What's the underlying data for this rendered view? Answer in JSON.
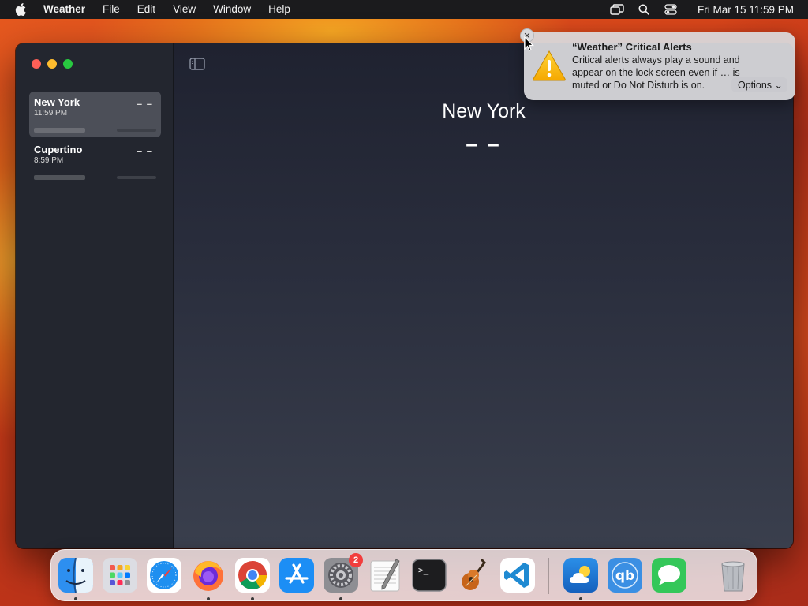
{
  "menubar": {
    "app_name": "Weather",
    "items": [
      "File",
      "Edit",
      "View",
      "Window",
      "Help"
    ],
    "clock": "Fri Mar 15  11:59 PM"
  },
  "sidebar": {
    "cities": [
      {
        "name": "New York",
        "time": "11:59 PM",
        "temp": "– –",
        "selected": true
      },
      {
        "name": "Cupertino",
        "time": "8:59 PM",
        "temp": "– –",
        "selected": false
      }
    ]
  },
  "main": {
    "city": "New York",
    "temp": "– –"
  },
  "notification": {
    "title": "“Weather” Critical Alerts",
    "body": "Critical alerts always play a sound and appear on the lock screen even if … is muted or Do Not Disturb is on.",
    "options_label": "Options ⌄"
  },
  "dock": {
    "apps": [
      "Finder",
      "Launchpad",
      "Safari",
      "Firefox",
      "Chrome",
      "App Store",
      "System Settings",
      "TextEdit",
      "Terminal",
      "GarageBand",
      "Visual Studio Code",
      "Weather",
      "qBittorrent",
      "Messages",
      "Trash"
    ],
    "settings_badge": "2"
  },
  "colors": {
    "accent_close": "#fe5f57",
    "accent_min": "#febc2e",
    "accent_max": "#28c840",
    "badge": "#f23d3d"
  }
}
